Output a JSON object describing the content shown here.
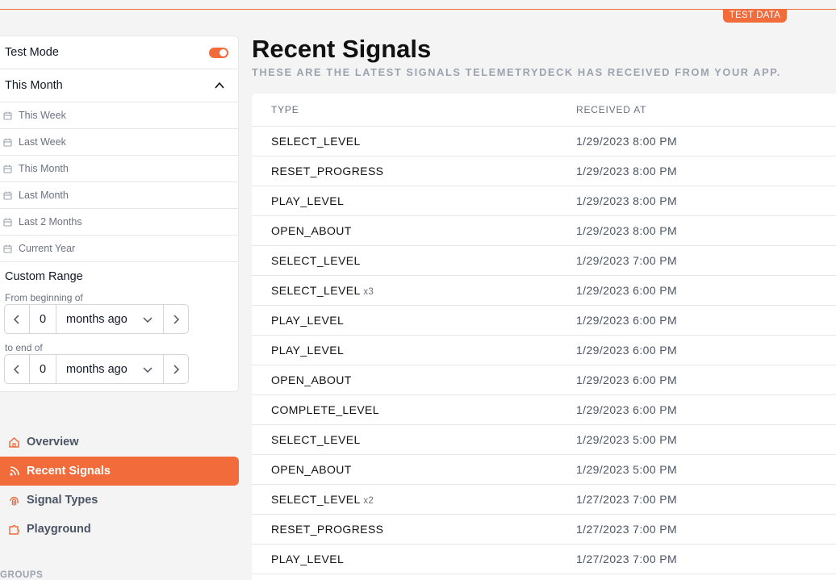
{
  "badge": "TEST DATA",
  "sidebar": {
    "test_mode_label": "Test Mode",
    "test_mode_on": true,
    "range_selected": "This Month",
    "presets": [
      "This Week",
      "Last Week",
      "This Month",
      "Last Month",
      "Last 2 Months",
      "Current Year"
    ],
    "custom_range": {
      "title": "Custom Range",
      "from_label": "From beginning of",
      "from_value": "0",
      "from_unit": "months ago",
      "to_label": "to end of",
      "to_value": "0",
      "to_unit": "months ago"
    },
    "nav": [
      {
        "label": "Overview",
        "icon": "home-icon",
        "active": false
      },
      {
        "label": "Recent Signals",
        "icon": "signal-icon",
        "active": true
      },
      {
        "label": "Signal Types",
        "icon": "fingerprint-icon",
        "active": false
      },
      {
        "label": "Playground",
        "icon": "puzzle-icon",
        "active": false
      }
    ],
    "groups_heading": "GROUPS"
  },
  "main": {
    "title": "Recent Signals",
    "subtitle": "THESE ARE THE LATEST SIGNALS TELEMETRYDECK HAS RECEIVED FROM YOUR APP.",
    "columns": [
      "TYPE",
      "RECEIVED AT"
    ],
    "rows": [
      {
        "type": "SELECT_LEVEL",
        "count": "",
        "received": "1/29/2023 8:00 PM"
      },
      {
        "type": "RESET_PROGRESS",
        "count": "",
        "received": "1/29/2023 8:00 PM"
      },
      {
        "type": "PLAY_LEVEL",
        "count": "",
        "received": "1/29/2023 8:00 PM"
      },
      {
        "type": "OPEN_ABOUT",
        "count": "",
        "received": "1/29/2023 8:00 PM"
      },
      {
        "type": "SELECT_LEVEL",
        "count": "",
        "received": "1/29/2023 7:00 PM"
      },
      {
        "type": "SELECT_LEVEL",
        "count": "x3",
        "received": "1/29/2023 6:00 PM"
      },
      {
        "type": "PLAY_LEVEL",
        "count": "",
        "received": "1/29/2023 6:00 PM"
      },
      {
        "type": "PLAY_LEVEL",
        "count": "",
        "received": "1/29/2023 6:00 PM"
      },
      {
        "type": "OPEN_ABOUT",
        "count": "",
        "received": "1/29/2023 6:00 PM"
      },
      {
        "type": "COMPLETE_LEVEL",
        "count": "",
        "received": "1/29/2023 6:00 PM"
      },
      {
        "type": "SELECT_LEVEL",
        "count": "",
        "received": "1/29/2023 5:00 PM"
      },
      {
        "type": "OPEN_ABOUT",
        "count": "",
        "received": "1/29/2023 5:00 PM"
      },
      {
        "type": "SELECT_LEVEL",
        "count": "x2",
        "received": "1/27/2023 7:00 PM"
      },
      {
        "type": "RESET_PROGRESS",
        "count": "",
        "received": "1/27/2023 7:00 PM"
      },
      {
        "type": "PLAY_LEVEL",
        "count": "",
        "received": "1/27/2023 7:00 PM"
      }
    ]
  },
  "colors": {
    "accent": "#f26b3a"
  }
}
